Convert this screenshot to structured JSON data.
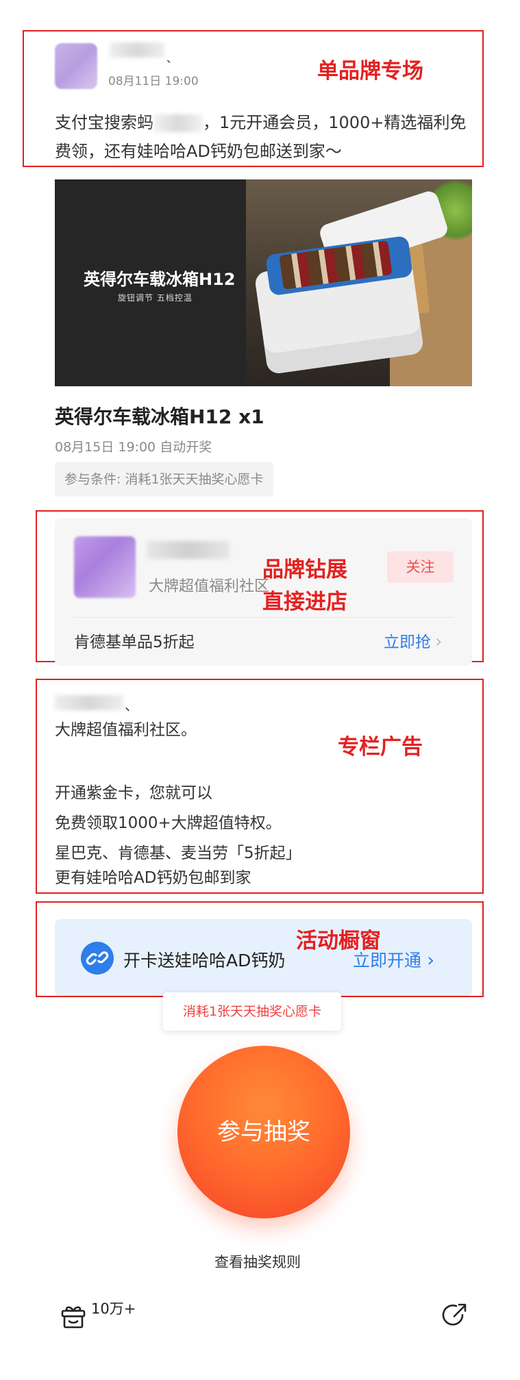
{
  "annotations": {
    "single_brand": "单品牌专场",
    "brand_showcase_line1": "品牌钻展",
    "brand_showcase_line2": "直接进店",
    "column_ad": "专栏广告",
    "activity_window": "活动橱窗"
  },
  "post": {
    "date": "08月11日 19:00",
    "text_part1": "支付宝搜索蚂",
    "text_part2": "，1元开通会员，1000+精选福利免费领，还有娃哈哈AD钙奶包邮送到家～"
  },
  "product": {
    "image_title": "英得尔车载冰箱H12",
    "image_subtitle": "旋钮调节  五档控温",
    "title": "英得尔车载冰箱H12  x1",
    "draw_time": "08月15日 19:00 自动开奖",
    "condition": "参与条件: 消耗1张天天抽奖心愿卡"
  },
  "brand_card": {
    "subtitle": "大牌超值福利社区",
    "follow_label": "关注",
    "promo": "肯德基单品5折起",
    "grab_label": "立即抢",
    "chevron": "›"
  },
  "column": {
    "lines": [
      "大牌超值福利社区。",
      "开通紫金卡，您就可以",
      "免费领取1000+大牌超值特权。",
      "星巴克、肯德基、麦当劳「5折起」",
      "更有娃哈哈AD钙奶包邮到家"
    ]
  },
  "activity": {
    "text": "开卡送娃哈哈AD钙奶",
    "action": "立即开通",
    "chevron": "›"
  },
  "lottery": {
    "consume_tip": "消耗1张天天抽奖心愿卡",
    "button_label": "参与抽奖",
    "rules_link": "查看抽奖规则",
    "participants": "10万+"
  },
  "icons": {
    "gift": "gift-icon",
    "share": "share-icon",
    "link": "link-icon"
  },
  "colors": {
    "annotation_red": "#e02020",
    "link_blue": "#2f7ee9",
    "lottery_orange": "#ff6a2c",
    "activity_bg": "#e7f1fd"
  }
}
